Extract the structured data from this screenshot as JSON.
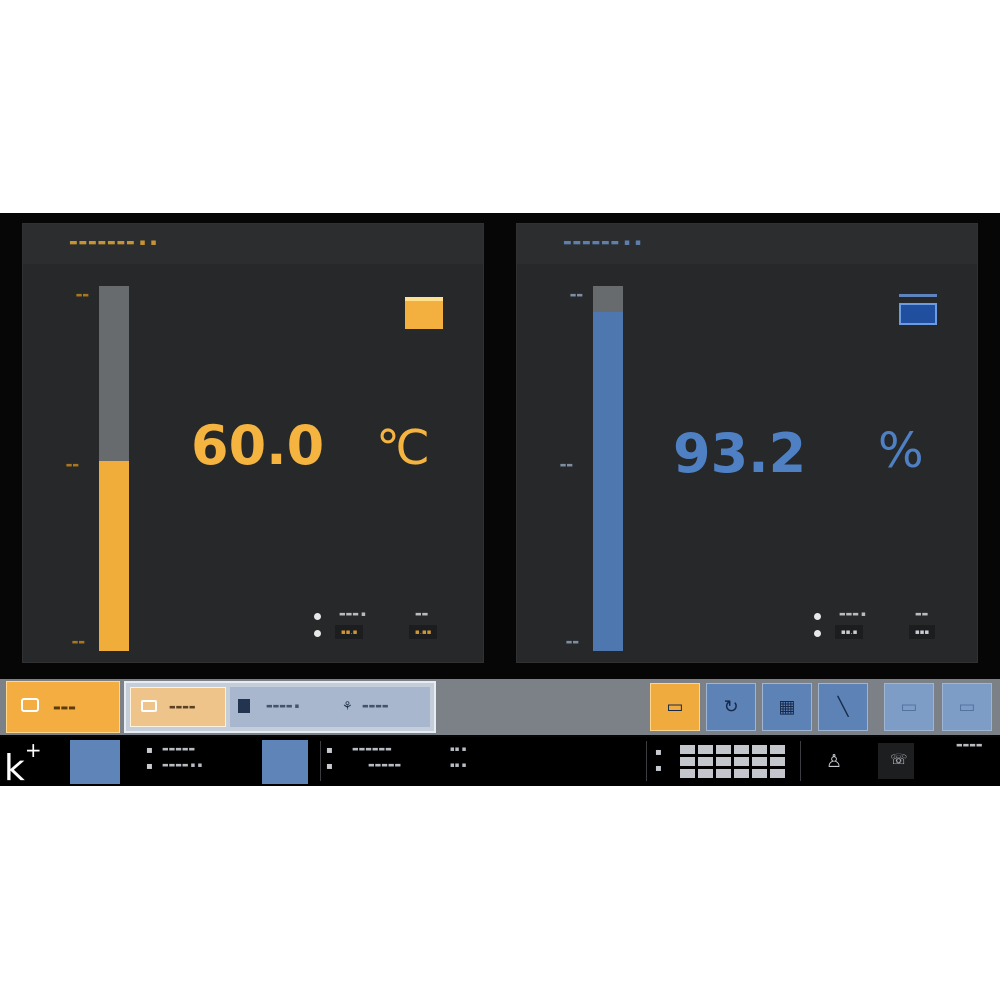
{
  "temperature_panel": {
    "value": "60.0",
    "unit": "℃",
    "fill_fraction": 0.52,
    "accent_color": "#f0ad3a"
  },
  "humidity_panel": {
    "value": "93.2",
    "unit": "%",
    "fill_fraction": 0.93,
    "accent_color": "#4e77b0"
  },
  "toolbar": {
    "icons": {
      "main": "monitor-icon",
      "sub1": "screen-icon",
      "sub2": "folder-icon",
      "sub3": "network-icon",
      "btn1": "display-icon",
      "btn2": "refresh-icon",
      "btn3": "grid-icon",
      "btn4": "curve-icon",
      "btn5": "window-icon",
      "btn6": "window-icon"
    }
  },
  "status_bar": {
    "logo": "k",
    "logo_sup": "+"
  }
}
